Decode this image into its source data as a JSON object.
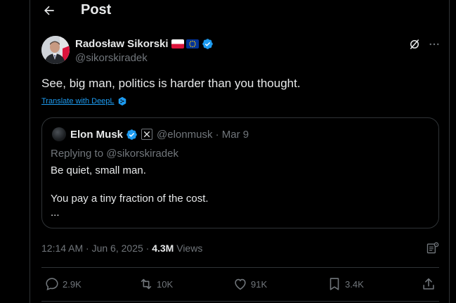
{
  "header": {
    "title": "Post",
    "back_icon": "arrow-left-icon"
  },
  "author": {
    "name": "Radosław Sikorski",
    "handle": "@sikorskiradek",
    "badges": [
      "flag-poland-icon",
      "flag-eu-icon",
      "verified-badge-icon"
    ],
    "verified_color": "#1d9bf0"
  },
  "tweet": {
    "text": "See, big man, politics is harder than you thought.",
    "translate_label": "Translate with DeepL"
  },
  "quote": {
    "name": "Elon Musk",
    "handle_date": "@elonmusk · Mar 9",
    "replying_to": "Replying to @sikorskiradek",
    "line1": "Be quiet, small man.",
    "line2": "You pay a tiny fraction of the cost.",
    "ellipsis": "..."
  },
  "meta": {
    "timestamp": "12:14 AM · Jun 6, 2025 · ",
    "views_count": "4.3M",
    "views_label": " Views"
  },
  "actions": {
    "reply": "2.9K",
    "repost": "10K",
    "like": "91K",
    "bookmark": "3.4K"
  },
  "colors": {
    "background": "#000000",
    "text": "#e7e9ea",
    "muted": "#71767b",
    "border": "#2f3336",
    "accent": "#1d9bf0"
  }
}
